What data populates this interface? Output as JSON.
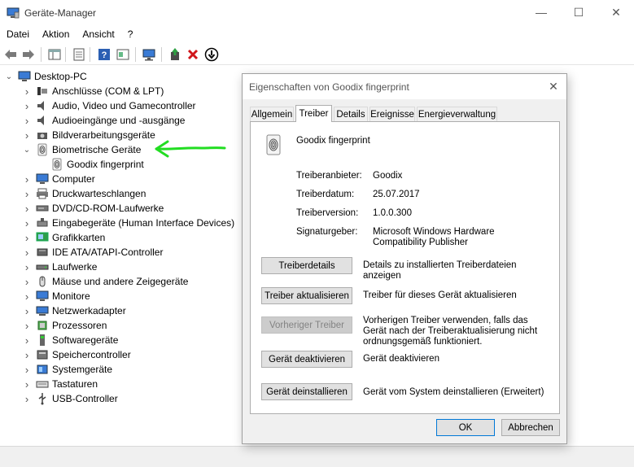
{
  "window": {
    "title": "Geräte-Manager",
    "controls": {
      "minimize": "—",
      "maximize": "☐",
      "close": "✕"
    }
  },
  "menu": [
    "Datei",
    "Aktion",
    "Ansicht",
    "?"
  ],
  "tree": {
    "root": "Desktop-PC",
    "items": [
      {
        "label": "Anschlüsse (COM & LPT)",
        "icon": "port-icon",
        "expanded": false
      },
      {
        "label": "Audio, Video und Gamecontroller",
        "icon": "speaker-icon",
        "expanded": false
      },
      {
        "label": "Audioeingänge und -ausgänge",
        "icon": "speaker-icon",
        "expanded": false
      },
      {
        "label": "Bildverarbeitungsgeräte",
        "icon": "camera-icon",
        "expanded": false
      },
      {
        "label": "Biometrische Geräte",
        "icon": "fingerprint-icon",
        "expanded": true
      },
      {
        "label": "Goodix fingerprint",
        "icon": "fingerprint-icon",
        "child": true
      },
      {
        "label": "Computer",
        "icon": "monitor-icon",
        "expanded": false
      },
      {
        "label": "Druckwarteschlangen",
        "icon": "printer-icon",
        "expanded": false
      },
      {
        "label": "DVD/CD-ROM-Laufwerke",
        "icon": "disc-icon",
        "expanded": false
      },
      {
        "label": "Eingabegeräte (Human Interface Devices)",
        "icon": "hid-icon",
        "expanded": false
      },
      {
        "label": "Grafikkarten",
        "icon": "display-adapter-icon",
        "expanded": false
      },
      {
        "label": "IDE ATA/ATAPI-Controller",
        "icon": "controller-icon",
        "expanded": false
      },
      {
        "label": "Laufwerke",
        "icon": "drive-icon",
        "expanded": false
      },
      {
        "label": "Mäuse und andere Zeigegeräte",
        "icon": "mouse-icon",
        "expanded": false
      },
      {
        "label": "Monitore",
        "icon": "monitor-icon",
        "expanded": false
      },
      {
        "label": "Netzwerkadapter",
        "icon": "network-icon",
        "expanded": false
      },
      {
        "label": "Prozessoren",
        "icon": "cpu-icon",
        "expanded": false
      },
      {
        "label": "Softwaregeräte",
        "icon": "software-device-icon",
        "expanded": false
      },
      {
        "label": "Speichercontroller",
        "icon": "storage-controller-icon",
        "expanded": false
      },
      {
        "label": "Systemgeräte",
        "icon": "system-device-icon",
        "expanded": false
      },
      {
        "label": "Tastaturen",
        "icon": "keyboard-icon",
        "expanded": false
      },
      {
        "label": "USB-Controller",
        "icon": "usb-icon",
        "expanded": false
      }
    ]
  },
  "dialog": {
    "title": "Eigenschaften von Goodix fingerprint",
    "tabs": [
      "Allgemein",
      "Treiber",
      "Details",
      "Ereignisse",
      "Energieverwaltung"
    ],
    "active_tab": "Treiber",
    "device_name": "Goodix fingerprint",
    "props": [
      {
        "label": "Treiberanbieter:",
        "value": "Goodix"
      },
      {
        "label": "Treiberdatum:",
        "value": "25.07.2017"
      },
      {
        "label": "Treiberversion:",
        "value": "1.0.0.300"
      },
      {
        "label": "Signaturgeber:",
        "value": "Microsoft Windows Hardware Compatibility Publisher"
      }
    ],
    "actions": [
      {
        "button": "Treiberdetails",
        "description": "Details zu installierten Treiberdateien anzeigen",
        "enabled": true
      },
      {
        "button": "Treiber aktualisieren",
        "description": "Treiber für dieses Gerät aktualisieren",
        "enabled": true
      },
      {
        "button": "Vorheriger Treiber",
        "description": "Vorherigen Treiber verwenden, falls das Gerät nach der Treiberaktualisierung nicht ordnungsgemäß funktioniert.",
        "enabled": false
      },
      {
        "button": "Gerät deaktivieren",
        "description": "Gerät deaktivieren",
        "enabled": true
      },
      {
        "button": "Gerät deinstallieren",
        "description": "Gerät vom System deinstallieren (Erweitert)",
        "enabled": true
      }
    ],
    "ok": "OK",
    "cancel": "Abbrechen"
  },
  "colors": {
    "annotation": "#22dd22",
    "accent": "#0078d7",
    "disabled_text": "#838383"
  }
}
